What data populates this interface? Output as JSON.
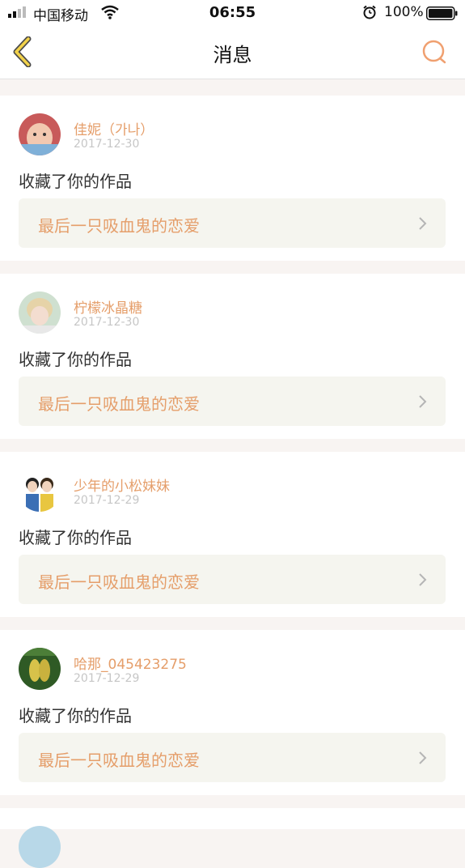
{
  "status_bar": {
    "carrier": "中国移动",
    "time": "06:55",
    "battery": "100%"
  },
  "nav": {
    "title": "消息",
    "back_icon": "chevron-left-icon",
    "search_icon": "search-icon"
  },
  "colors": {
    "accent": "#e59e6a",
    "date": "#c6c6c6",
    "card_bg": "#f5f5ef"
  },
  "messages": [
    {
      "user": "佳妮（가나）",
      "date": "2017-12-30",
      "action": "收藏了你的作品",
      "work": "最后一只吸血鬼的恋爱"
    },
    {
      "user": "柠檬冰晶糖",
      "date": "2017-12-30",
      "action": "收藏了你的作品",
      "work": "最后一只吸血鬼的恋爱"
    },
    {
      "user": "少年的小松妹妹",
      "date": "2017-12-29",
      "action": "收藏了你的作品",
      "work": "最后一只吸血鬼的恋爱"
    },
    {
      "user": "哈那_045423275",
      "date": "2017-12-29",
      "action": "收藏了你的作品",
      "work": "最后一只吸血鬼的恋爱"
    }
  ]
}
